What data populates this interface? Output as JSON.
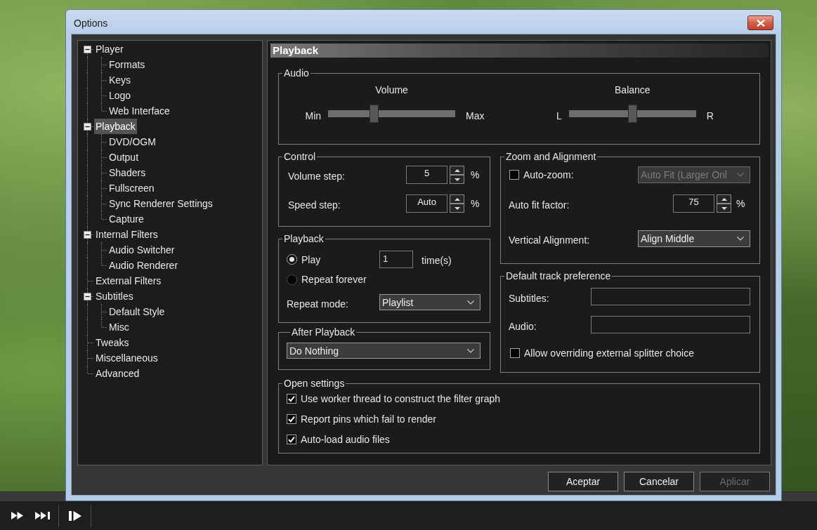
{
  "window": {
    "title": "Options"
  },
  "tree": [
    {
      "label": "Player",
      "selected": false,
      "expanded": true,
      "children": [
        {
          "label": "Formats",
          "selected": false
        },
        {
          "label": "Keys",
          "selected": false
        },
        {
          "label": "Logo",
          "selected": false
        },
        {
          "label": "Web Interface",
          "selected": false
        }
      ]
    },
    {
      "label": "Playback",
      "selected": true,
      "expanded": true,
      "children": [
        {
          "label": "DVD/OGM",
          "selected": false
        },
        {
          "label": "Output",
          "selected": false
        },
        {
          "label": "Shaders",
          "selected": false
        },
        {
          "label": "Fullscreen",
          "selected": false
        },
        {
          "label": "Sync Renderer Settings",
          "selected": false
        },
        {
          "label": "Capture",
          "selected": false
        }
      ]
    },
    {
      "label": "Internal Filters",
      "selected": false,
      "expanded": true,
      "children": [
        {
          "label": "Audio Switcher",
          "selected": false
        },
        {
          "label": "Audio Renderer",
          "selected": false
        }
      ]
    },
    {
      "label": "External Filters",
      "selected": false
    },
    {
      "label": "Subtitles",
      "selected": false,
      "expanded": true,
      "children": [
        {
          "label": "Default Style",
          "selected": false
        },
        {
          "label": "Misc",
          "selected": false
        }
      ]
    },
    {
      "label": "Tweaks",
      "selected": false
    },
    {
      "label": "Miscellaneous",
      "selected": false
    },
    {
      "label": "Advanced",
      "selected": false
    }
  ],
  "page": {
    "title": "Playback"
  },
  "audio": {
    "title": "Audio",
    "sliders": [
      {
        "label": "Volume",
        "min_label": "Min",
        "max_label": "Max",
        "level": 0.35
      },
      {
        "label": "Balance",
        "min_label": "L",
        "max_label": "R",
        "level": 0.5
      }
    ]
  },
  "control": {
    "title": "Control",
    "rows": [
      {
        "label": "Volume step:",
        "value": "5",
        "unit": "%"
      },
      {
        "label": "Speed step:",
        "value": "Auto",
        "unit": "%"
      }
    ]
  },
  "zoom_alignment": {
    "title": "Zoom and Alignment",
    "auto_zoom": {
      "label": "Auto-zoom:",
      "checked": false
    },
    "auto_zoom_mode": {
      "value": "Auto Fit (Larger Onl",
      "disabled": true
    },
    "auto_fit_factor": {
      "label": "Auto fit factor:",
      "value": "75",
      "unit": "%"
    },
    "vertical_alignment": {
      "label": "Vertical Alignment:",
      "value": "Align Middle"
    }
  },
  "playback": {
    "title": "Playback",
    "options": [
      {
        "label": "Play",
        "selected": true
      },
      {
        "label": "Repeat forever",
        "selected": false
      }
    ],
    "play_times": {
      "value": "1",
      "unit": "time(s)"
    },
    "repeat_mode": {
      "label": "Repeat mode:",
      "value": "Playlist"
    }
  },
  "after_playback": {
    "title": "After Playback",
    "value": "Do Nothing"
  },
  "default_track": {
    "title": "Default track preference",
    "fields": [
      {
        "label": "Subtitles:"
      },
      {
        "label": "Audio:"
      }
    ],
    "override": {
      "label": "Allow overriding external splitter choice",
      "checked": false
    }
  },
  "open_settings": {
    "title": "Open settings",
    "options": [
      {
        "label": "Use worker thread to construct the filter graph",
        "checked": true
      },
      {
        "label": "Report pins which fail to render",
        "checked": true
      },
      {
        "label": "Auto-load audio files",
        "checked": true
      }
    ]
  },
  "buttons": [
    {
      "label": "Aceptar",
      "disabled": false
    },
    {
      "label": "Cancelar",
      "disabled": false
    },
    {
      "label": "Aplicar",
      "disabled": true
    }
  ]
}
